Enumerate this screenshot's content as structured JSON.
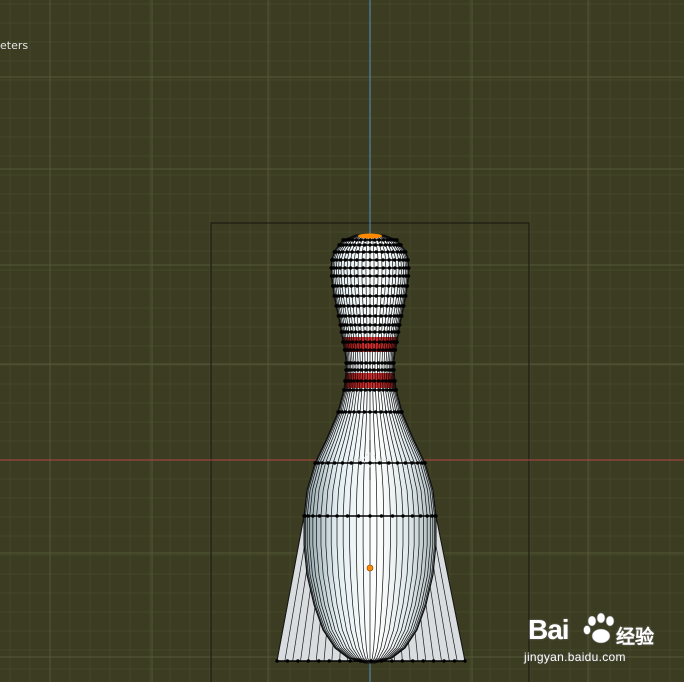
{
  "viewport": {
    "units_label": "eters",
    "background_color": "#3b3c21",
    "x_axis_color": "#b34848",
    "z_axis_color": "#5a8fc0"
  },
  "object": {
    "type": "mesh",
    "name_shown": "",
    "stripe_color": "#c42020",
    "body_color": "#eef4f6",
    "vertex_color": "#000000",
    "selected_vertex_color": "#ff8a00"
  },
  "watermark": {
    "brand": "Bai",
    "brand_suffix": "百度",
    "cn_label": "经验",
    "url": "jingyan.baidu.com"
  }
}
